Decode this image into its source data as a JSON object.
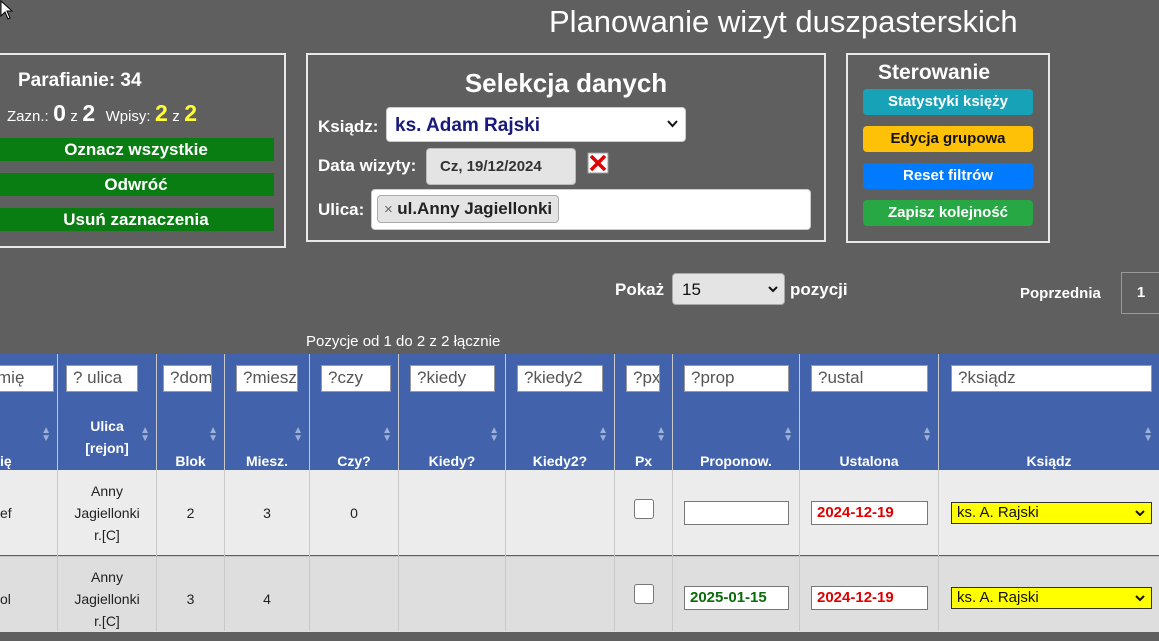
{
  "page_title": "Planowanie wizyt duszpasterskich",
  "summary": {
    "parishioners_label": "Parafianie: 34",
    "selected_label": "Zazn.:",
    "selected_value": "0",
    "z1": "z",
    "selected_total": "2",
    "entries_label": "Wpisy:",
    "entries_value": "2",
    "z2": "z",
    "entries_total": "2",
    "btn_mark_all": "Oznacz wszystkie",
    "btn_invert": "Odwróć",
    "btn_clear": "Usuń zaznaczenia"
  },
  "selection": {
    "heading": "Selekcja danych",
    "priest_label": "Ksiądz:",
    "priest_value": "ks. Adam Rajski",
    "date_label": "Data wizyty:",
    "date_value": "Cz, 19/12/2024",
    "street_label": "Ulica:",
    "street_tag": "ul.Anny Jagiellonki",
    "tag_remove": "×"
  },
  "control": {
    "heading": "Sterowanie",
    "btn_stats": "Statystyki księży",
    "btn_group_edit": "Edycja grupowa",
    "btn_reset": "Reset filtrów",
    "btn_save_order": "Zapisz kolejność",
    "colors": {
      "teal": "#17a2b8",
      "yellow": "#ffc107",
      "blue": "#007bff",
      "green": "#28a745"
    }
  },
  "pager": {
    "show_label": "Pokaż",
    "show_value": "15",
    "positions_label": "pozycji",
    "prev_label": "Poprzednia",
    "page_num": "1",
    "info": "Pozycje od 1 do 2 z 2 łącznie"
  },
  "filters": [
    "mię",
    "? ulica",
    "?dom",
    "?miesz",
    "?czy",
    "?kiedy",
    "?kiedy2",
    "?px",
    "?prop",
    "?ustal",
    "?ksiądz"
  ],
  "headers": {
    "name": "ię",
    "street_1": "Ulica",
    "street_2": "[rejon]",
    "block": "Blok",
    "apt": "Miesz.",
    "czy": "Czy?",
    "kiedy": "Kiedy?",
    "kiedy2": "Kiedy2?",
    "px": "Px",
    "prop": "Proponow.",
    "ustal": "Ustalona",
    "priest": "Ksiądz"
  },
  "rows": [
    {
      "name": "ef",
      "street_1": "Anny",
      "street_2": "Jagiellonki",
      "street_3": "r.[C]",
      "block": "2",
      "apt": "3",
      "czy": "0",
      "kiedy": "",
      "kiedy2": "",
      "prop": "",
      "ustal": "2024-12-19",
      "priest": "ks. A. Rajski"
    },
    {
      "name": "ol",
      "street_1": "Anny",
      "street_2": "Jagiellonki",
      "street_3": "r.[C]",
      "block": "3",
      "apt": "4",
      "czy": "",
      "kiedy": "",
      "kiedy2": "",
      "prop": "2025-01-15",
      "ustal": "2024-12-19",
      "priest": "ks. A. Rajski"
    }
  ]
}
